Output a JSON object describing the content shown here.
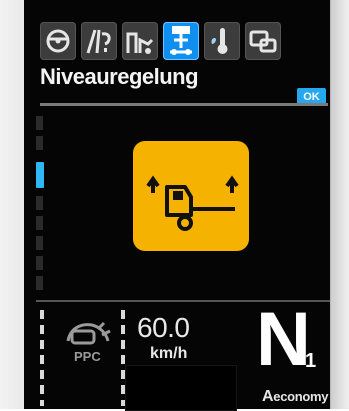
{
  "icon_bar": {
    "items": [
      {
        "icon": "steering-wheel-icon",
        "active": false
      },
      {
        "icon": "road-warning-icon",
        "active": false
      },
      {
        "icon": "suspension-icon",
        "active": false
      },
      {
        "icon": "level-control-icon",
        "active": true
      },
      {
        "icon": "temperature-icon",
        "active": false
      },
      {
        "icon": "settings-icon",
        "active": false
      }
    ]
  },
  "screen": {
    "title": "Niveauregelung",
    "ok_label": "OK",
    "warning_icon": "truck-level-raise-icon"
  },
  "status": {
    "ppc_label": "PPC",
    "speed_value": "60.0",
    "speed_unit": "km/h",
    "gear_letter": "N",
    "gear_sub": "1",
    "mode_prefix": "A",
    "mode_label": "economy"
  },
  "colors": {
    "accent_blue": "#0f8ff0",
    "warning_amber": "#f6b200",
    "background": "#050505",
    "text": "#f4f4f4"
  }
}
